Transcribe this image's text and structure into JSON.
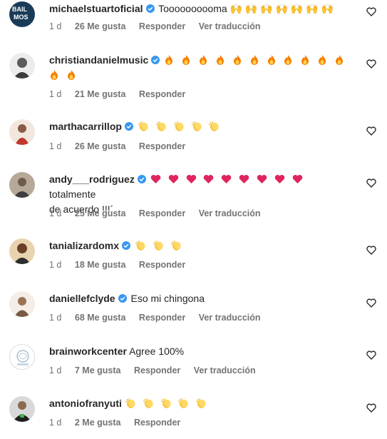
{
  "comments": [
    {
      "user": "michaelstuartoficial",
      "verified": true,
      "text": "Toooooooooma",
      "emoji": "🙌 🙌 🙌 🙌 🙌 🙌 🙌",
      "time": "1 d",
      "likes": "26 Me gusta",
      "reply": "Responder",
      "translate": "Ver traducción"
    },
    {
      "user": "christiandanielmusic",
      "verified": true,
      "text": "",
      "time": "1 d",
      "likes": "21 Me gusta",
      "reply": "Responder"
    },
    {
      "user": "marthacarrillop",
      "verified": true,
      "text": "",
      "time": "1 d",
      "likes": "26 Me gusta",
      "reply": "Responder"
    },
    {
      "user": "andy___rodriguez",
      "verified": true,
      "text": "totalmente",
      "text2": "de acuerdo !!!´",
      "time": "1 d",
      "likes": "25 Me gusta",
      "reply": "Responder",
      "translate": "Ver traducción"
    },
    {
      "user": "tanializardomx",
      "verified": true,
      "text": "",
      "time": "1 d",
      "likes": "18 Me gusta",
      "reply": "Responder"
    },
    {
      "user": "daniellefclyde",
      "verified": true,
      "text": "Eso mi chingona",
      "time": "1 d",
      "likes": "68 Me gusta",
      "reply": "Responder",
      "translate": "Ver traducción"
    },
    {
      "user": "brainworkcenter",
      "verified": false,
      "text": "Agree 100%",
      "time": "1 d",
      "likes": "7 Me gusta",
      "reply": "Responder",
      "translate": "Ver traducción"
    },
    {
      "user": "antoniofranyuti",
      "verified": false,
      "text": "",
      "time": "1 d",
      "likes": "2 Me gusta",
      "reply": "Responder"
    }
  ],
  "icons": {
    "verified": "verified-badge-icon",
    "like": "heart-outline-icon"
  },
  "colors": {
    "verified": "#3897f0",
    "meta": "#737373",
    "fire": "#f77f00",
    "heart": "#e0245e",
    "clap": "#f7c948"
  }
}
